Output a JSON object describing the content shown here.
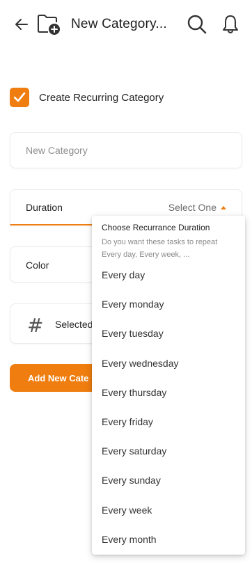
{
  "header": {
    "title": "New Category...",
    "back_icon": "arrow-left-icon",
    "folder_icon": "folder-add-icon",
    "search_icon": "search-icon",
    "bell_icon": "bell-icon"
  },
  "recurring": {
    "checked": true,
    "label": "Create Recurring Category"
  },
  "name_field": {
    "placeholder": "New Category"
  },
  "duration_field": {
    "label": "Duration",
    "value": "Select One"
  },
  "color_field": {
    "label": "Color"
  },
  "icon_field": {
    "label": "Selected"
  },
  "add_button": {
    "label": "Add New Cate"
  },
  "dropdown": {
    "title": "Choose Recurrance Duration",
    "subtitle": "Do you want these tasks to repeat Every day, Every week, ...",
    "options": [
      "Every day",
      "Every monday",
      "Every tuesday",
      "Every wednesday",
      "Every thursday",
      "Every friday",
      "Every saturday",
      "Every sunday",
      "Every week",
      "Every month"
    ]
  },
  "colors": {
    "accent": "#ef7d0f"
  }
}
